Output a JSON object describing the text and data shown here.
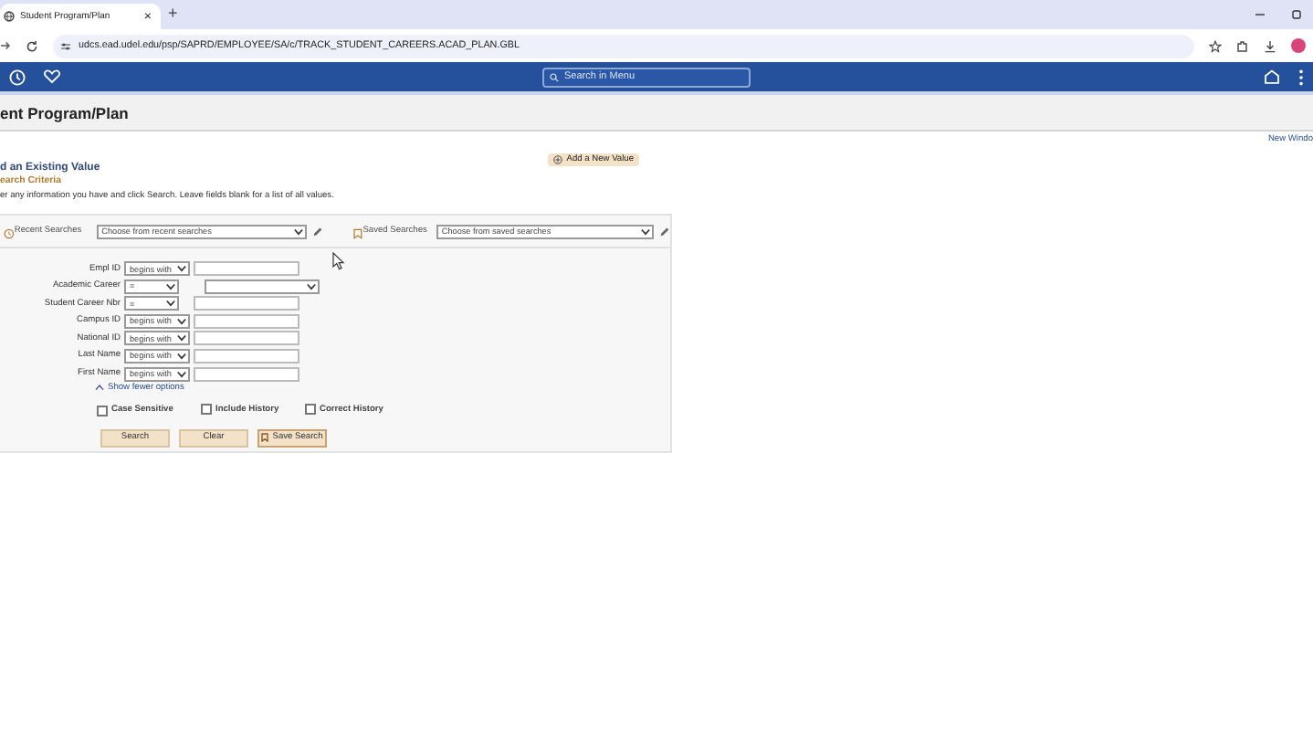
{
  "browser": {
    "tab_title": "Student Program/Plan",
    "tab_close": "×",
    "new_tab": "+",
    "url": "udcs.ead.udel.edu/psp/SAPRD/EMPLOYEE/SA/c/TRACK_STUDENT_CAREERS.ACAD_PLAN.GBL"
  },
  "navbar": {
    "search_placeholder": "Search in Menu"
  },
  "page": {
    "title": "ent Program/Plan",
    "new_window_link": "New Windo",
    "add_new_value": "Add a New Value",
    "heading": "d an Existing Value",
    "subheading": "earch Criteria",
    "instructions": "er any information you have and click Search. Leave fields blank for a list of all values."
  },
  "searches": {
    "recent_label": "Recent Searches",
    "recent_placeholder": "Choose from recent searches",
    "saved_label": "Saved Searches",
    "saved_placeholder": "Choose from saved searches"
  },
  "fields": [
    {
      "label": "Empl ID",
      "operator": "begins with",
      "kind": "text"
    },
    {
      "label": "Academic Career",
      "operator": "=",
      "kind": "select"
    },
    {
      "label": "Student Career Nbr",
      "operator": "=",
      "kind": "text"
    },
    {
      "label": "Campus ID",
      "operator": "begins with",
      "kind": "text"
    },
    {
      "label": "National ID",
      "operator": "begins with",
      "kind": "text"
    },
    {
      "label": "Last Name",
      "operator": "begins with",
      "kind": "text"
    },
    {
      "label": "First Name",
      "operator": "begins with",
      "kind": "text"
    }
  ],
  "show_fewer": "Show fewer options",
  "checkboxes": [
    {
      "label": "Case Sensitive",
      "checked": false
    },
    {
      "label": "Include History",
      "checked": false
    },
    {
      "label": "Correct History",
      "checked": false
    }
  ],
  "buttons": [
    {
      "label": "Search",
      "kind": "plain"
    },
    {
      "label": "Clear",
      "kind": "plain"
    },
    {
      "label": "Save Search",
      "kind": "bookmark"
    }
  ]
}
